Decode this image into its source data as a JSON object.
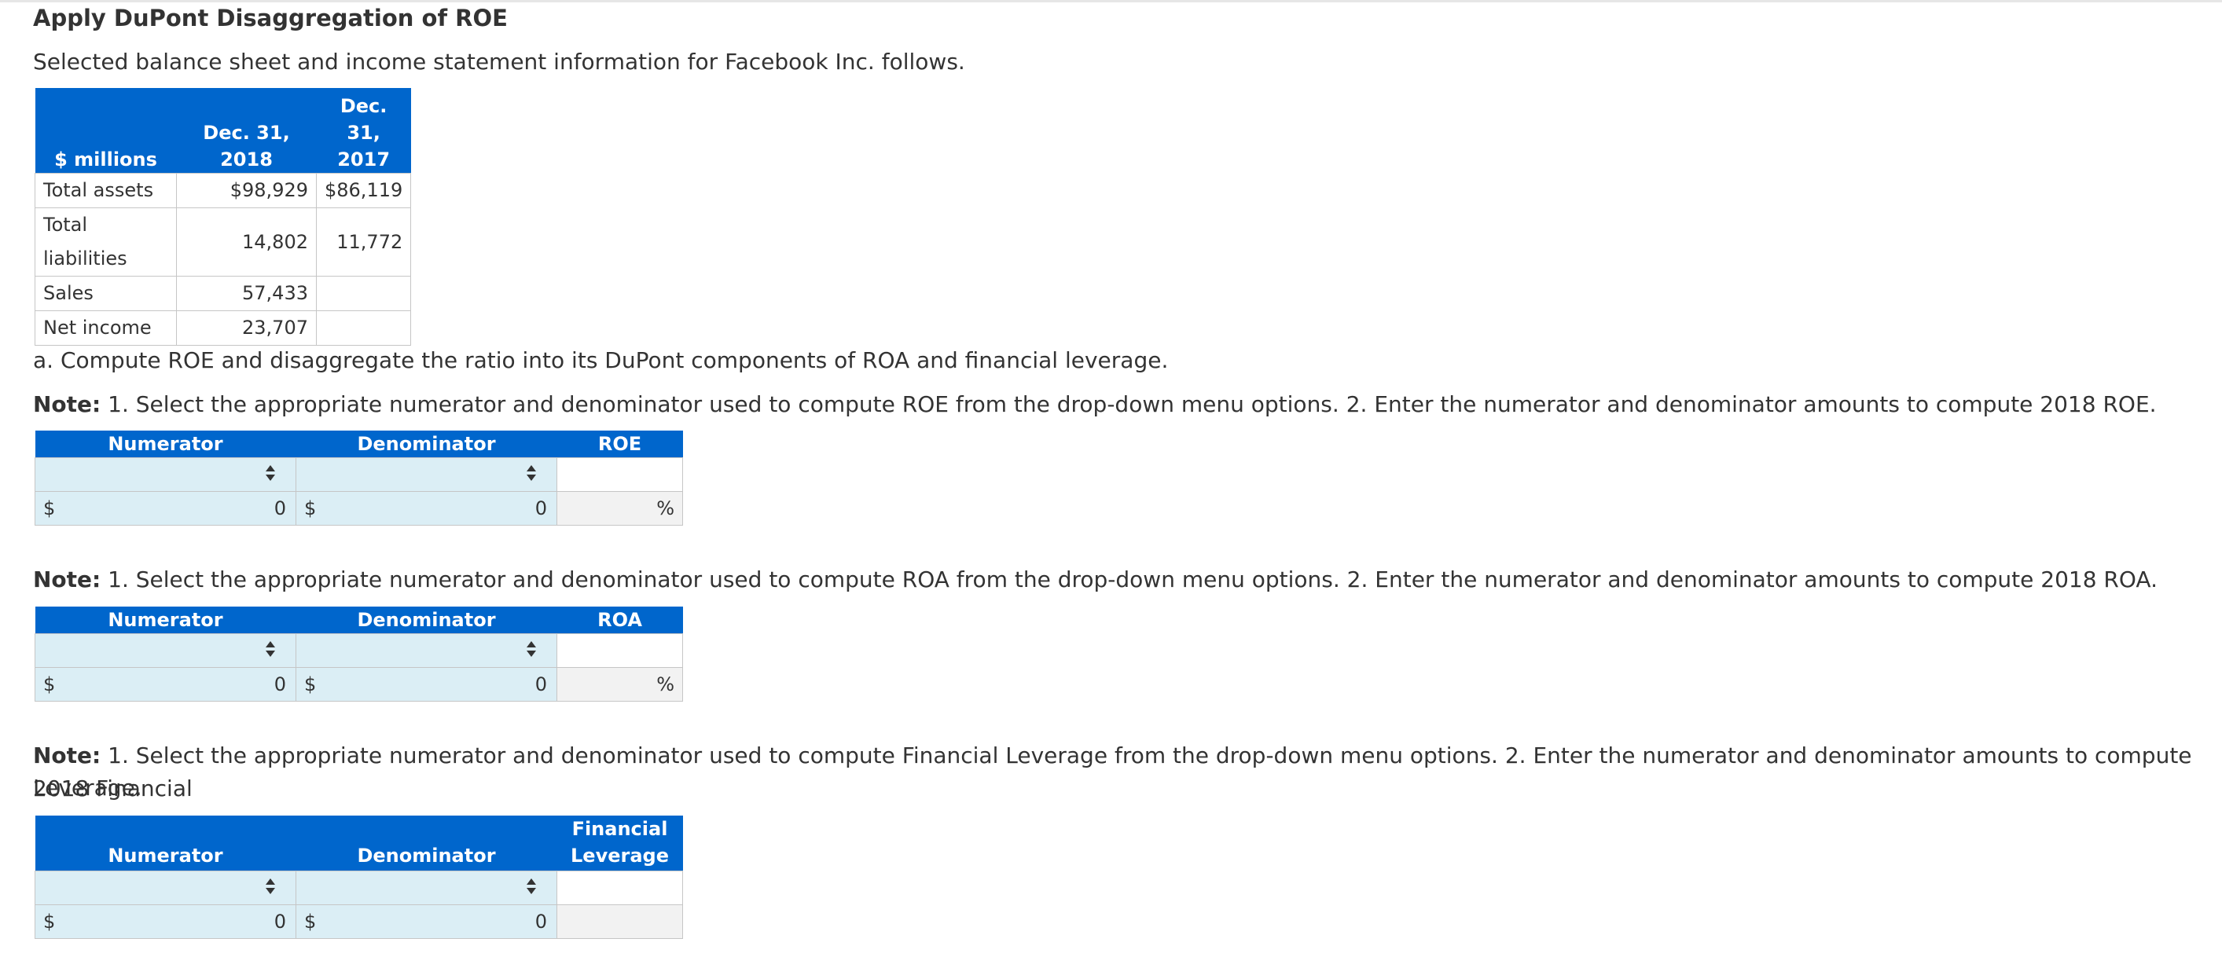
{
  "title": "Apply DuPont Disaggregation of ROE",
  "intro": "Selected balance sheet and income statement information for Facebook Inc. follows.",
  "balance_table": {
    "headers": [
      "$ millions",
      "Dec. 31, 2018",
      "Dec. 31, 2017"
    ],
    "header_2017_lines": [
      "Dec.",
      "31,",
      "2017"
    ],
    "rows": [
      {
        "label": "Total assets",
        "y2018": "$98,929",
        "y2017": "$86,119"
      },
      {
        "label": "Total liabilities",
        "y2018": "14,802",
        "y2017": "11,772"
      },
      {
        "label": "Sales",
        "y2018": "57,433",
        "y2017": ""
      },
      {
        "label": "Net income",
        "y2018": "23,707",
        "y2017": ""
      }
    ]
  },
  "question_a": "a. Compute ROE and disaggregate the ratio into its DuPont components of ROA and financial leverage.",
  "note_label": "Note:",
  "roe": {
    "note": " 1. Select the appropriate numerator and denominator used to compute ROE from the drop-down menu options. 2. Enter the numerator and denominator amounts to compute 2018 ROE.",
    "headers": {
      "numerator": "Numerator",
      "denominator": "Denominator",
      "result": "ROE"
    },
    "currency": "$",
    "numerator_value": "0",
    "denominator_value": "0",
    "result_unit": "%"
  },
  "roa": {
    "note": " 1. Select the appropriate numerator and denominator used to compute ROA from the drop-down menu options. 2. Enter the numerator and denominator amounts to compute 2018 ROA.",
    "headers": {
      "numerator": "Numerator",
      "denominator": "Denominator",
      "result": "ROA"
    },
    "currency": "$",
    "numerator_value": "0",
    "denominator_value": "0",
    "result_unit": "%"
  },
  "fl": {
    "note_line1": " 1. Select the appropriate numerator and denominator used to compute Financial Leverage from the drop-down menu options. 2. Enter the numerator and denominator amounts to compute 2018 Financial",
    "note_line2": "Leverage.",
    "headers": {
      "numerator": "Numerator",
      "denominator": "Denominator",
      "result_line1": "Financial",
      "result_line2": "Leverage"
    },
    "currency": "$",
    "numerator_value": "0",
    "denominator_value": "0"
  },
  "colors": {
    "header_blue": "#0066cc",
    "input_bg": "#dbeef5",
    "result_bg": "#f2f2f2",
    "border": "#c6c6c6"
  }
}
